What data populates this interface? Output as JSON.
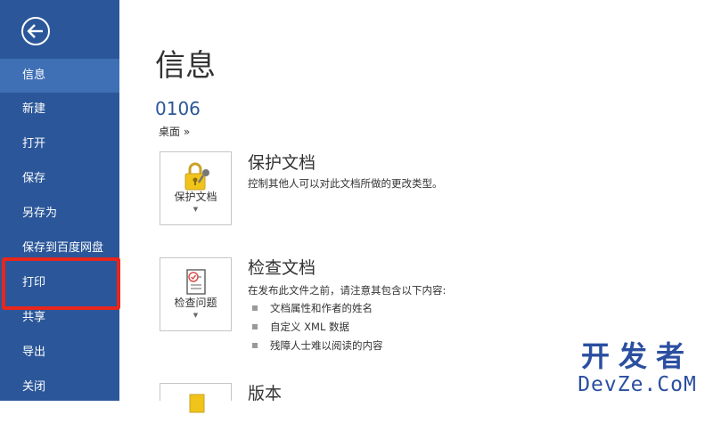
{
  "sidebar": {
    "back_label": "Back",
    "items": [
      {
        "label": "信息",
        "active": true
      },
      {
        "label": "新建"
      },
      {
        "label": "打开"
      },
      {
        "label": "保存"
      },
      {
        "label": "另存为"
      },
      {
        "label": "保存到百度网盘"
      },
      {
        "label": "打印",
        "highlighted": true
      },
      {
        "label": "共享"
      },
      {
        "label": "导出"
      },
      {
        "label": "关闭"
      }
    ]
  },
  "main": {
    "title": "信息",
    "document_name": "0106",
    "location": "桌面 »",
    "sections": [
      {
        "tile_label": "保护文档",
        "tile_icon": "lock-key-icon",
        "title": "保护文档",
        "description": "控制其他人可以对此文档所做的更改类型。"
      },
      {
        "tile_label": "检查问题",
        "tile_icon": "inspect-document-icon",
        "title": "检查文档",
        "description": "在发布此文件之前，请注意其包含以下内容:",
        "bullets": [
          "文档属性和作者的姓名",
          "自定义 XML 数据",
          "残障人士难以阅读的内容"
        ]
      },
      {
        "tile_label": "",
        "tile_icon": "versions-icon",
        "title": "版本"
      }
    ]
  },
  "watermark": {
    "text_cn": "开发者",
    "text_en": "DevZe.CoM"
  },
  "colors": {
    "sidebar_bg": "#2b579a",
    "active_item_bg": "#3f6fb5",
    "highlight_border": "#e8261c",
    "accent_text": "#2b579a"
  }
}
